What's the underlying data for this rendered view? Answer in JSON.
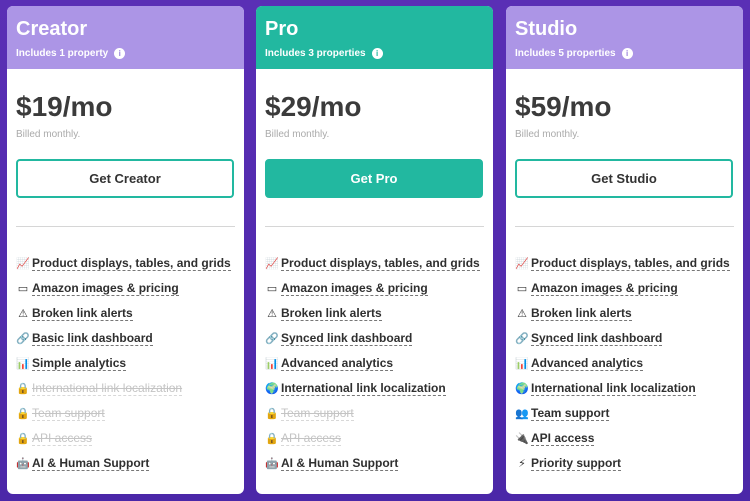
{
  "plans": [
    {
      "name": "Creator",
      "subtitle": "Includes 1 property",
      "price": "$19/mo",
      "billing": "Billed monthly.",
      "cta": "Get Creator",
      "cta_style": "outline",
      "header_color": "#ac95e6",
      "features": [
        {
          "icon": "chart-icon",
          "glyph": "📈",
          "text": "Product displays, tables, and grids",
          "disabled": false
        },
        {
          "icon": "amazon-icon",
          "glyph": "▭",
          "text": "Amazon images & pricing",
          "disabled": false
        },
        {
          "icon": "warning-icon",
          "glyph": "⚠",
          "text": "Broken link alerts",
          "disabled": false
        },
        {
          "icon": "link-icon",
          "glyph": "🔗",
          "text": "Basic link dashboard",
          "disabled": false
        },
        {
          "icon": "analytics-icon",
          "glyph": "📊",
          "text": "Simple analytics",
          "disabled": false
        },
        {
          "icon": "lock-icon",
          "glyph": "🔒",
          "text": "International link localization",
          "disabled": true
        },
        {
          "icon": "lock-icon",
          "glyph": "🔒",
          "text": "Team support",
          "disabled": true
        },
        {
          "icon": "lock-icon",
          "glyph": "🔒",
          "text": "API access",
          "disabled": true
        },
        {
          "icon": "support-icon",
          "glyph": "🤖",
          "text": "AI & Human Support",
          "disabled": false
        }
      ]
    },
    {
      "name": "Pro",
      "subtitle": "Includes 3 properties",
      "price": "$29/mo",
      "billing": "Billed monthly.",
      "cta": "Get Pro",
      "cta_style": "solid",
      "header_color": "#22b8a0",
      "features": [
        {
          "icon": "chart-icon",
          "glyph": "📈",
          "text": "Product displays, tables, and grids",
          "disabled": false
        },
        {
          "icon": "amazon-icon",
          "glyph": "▭",
          "text": "Amazon images & pricing",
          "disabled": false
        },
        {
          "icon": "warning-icon",
          "glyph": "⚠",
          "text": "Broken link alerts",
          "disabled": false
        },
        {
          "icon": "link-icon",
          "glyph": "🔗",
          "text": "Synced link dashboard",
          "disabled": false
        },
        {
          "icon": "analytics-icon",
          "glyph": "📊",
          "text": "Advanced analytics",
          "disabled": false
        },
        {
          "icon": "globe-icon",
          "glyph": "🌍",
          "text": "International link localization",
          "disabled": false
        },
        {
          "icon": "lock-icon",
          "glyph": "🔒",
          "text": "Team support",
          "disabled": true
        },
        {
          "icon": "lock-icon",
          "glyph": "🔒",
          "text": "API access",
          "disabled": true
        },
        {
          "icon": "support-icon",
          "glyph": "🤖",
          "text": "AI & Human Support",
          "disabled": false
        }
      ]
    },
    {
      "name": "Studio",
      "subtitle": "Includes 5 properties",
      "price": "$59/mo",
      "billing": "Billed monthly.",
      "cta": "Get Studio",
      "cta_style": "outline",
      "header_color": "#ac95e6",
      "features": [
        {
          "icon": "chart-icon",
          "glyph": "📈",
          "text": "Product displays, tables, and grids",
          "disabled": false
        },
        {
          "icon": "amazon-icon",
          "glyph": "▭",
          "text": "Amazon images & pricing",
          "disabled": false
        },
        {
          "icon": "warning-icon",
          "glyph": "⚠",
          "text": "Broken link alerts",
          "disabled": false
        },
        {
          "icon": "link-icon",
          "glyph": "🔗",
          "text": "Synced link dashboard",
          "disabled": false
        },
        {
          "icon": "analytics-icon",
          "glyph": "📊",
          "text": "Advanced analytics",
          "disabled": false
        },
        {
          "icon": "globe-icon",
          "glyph": "🌍",
          "text": "International link localization",
          "disabled": false
        },
        {
          "icon": "team-icon",
          "glyph": "👥",
          "text": "Team support",
          "disabled": false
        },
        {
          "icon": "plug-icon",
          "glyph": "🔌",
          "text": "API access",
          "disabled": false
        },
        {
          "icon": "bolt-icon",
          "glyph": "⚡",
          "text": "Priority support",
          "disabled": false
        }
      ]
    }
  ],
  "colors": {
    "background": "#5a2fb5",
    "accent_green": "#22b8a0",
    "header_purple": "#ac95e6"
  }
}
